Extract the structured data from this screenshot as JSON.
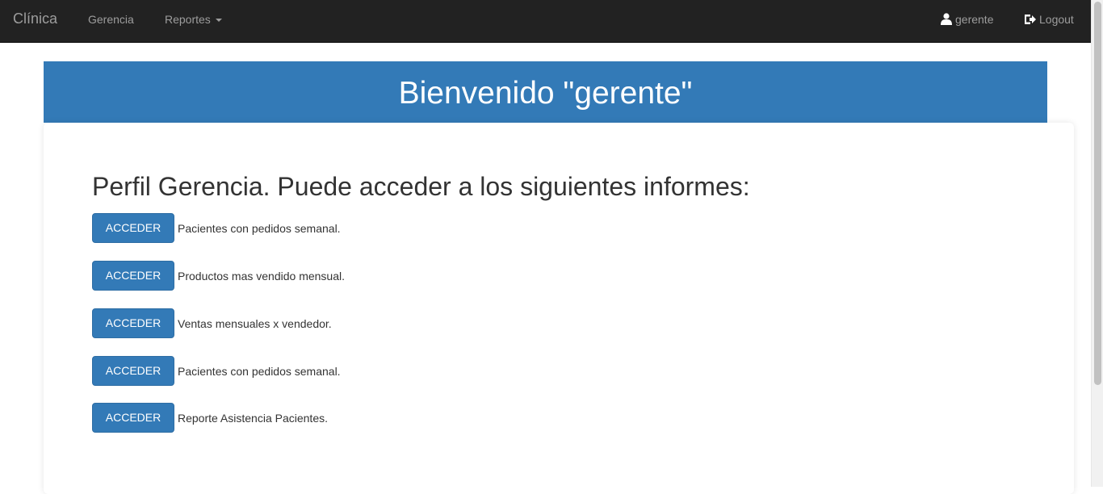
{
  "navbar": {
    "brand": "Clínica",
    "items": [
      {
        "label": "Gerencia"
      },
      {
        "label": "Reportes"
      }
    ],
    "user": "gerente",
    "logout": "Logout"
  },
  "banner": {
    "title": "Bienvenido \"gerente\""
  },
  "main": {
    "heading": "Perfil Gerencia. Puede acceder a los siguientes informes:",
    "reports": [
      {
        "button": "ACCEDER",
        "label": "Pacientes con pedidos semanal."
      },
      {
        "button": "ACCEDER",
        "label": "Productos mas vendido mensual."
      },
      {
        "button": "ACCEDER",
        "label": "Ventas mensuales x vendedor."
      },
      {
        "button": "ACCEDER",
        "label": "Pacientes con pedidos semanal."
      },
      {
        "button": "ACCEDER",
        "label": "Reporte Asistencia Pacientes."
      }
    ]
  },
  "colors": {
    "navbar": "#222222",
    "primary": "#337ab7",
    "nav_text": "#9d9d9d"
  },
  "icons": {
    "user": "user-icon",
    "logout": "logout-icon",
    "dropdown": "caret-down-icon"
  }
}
